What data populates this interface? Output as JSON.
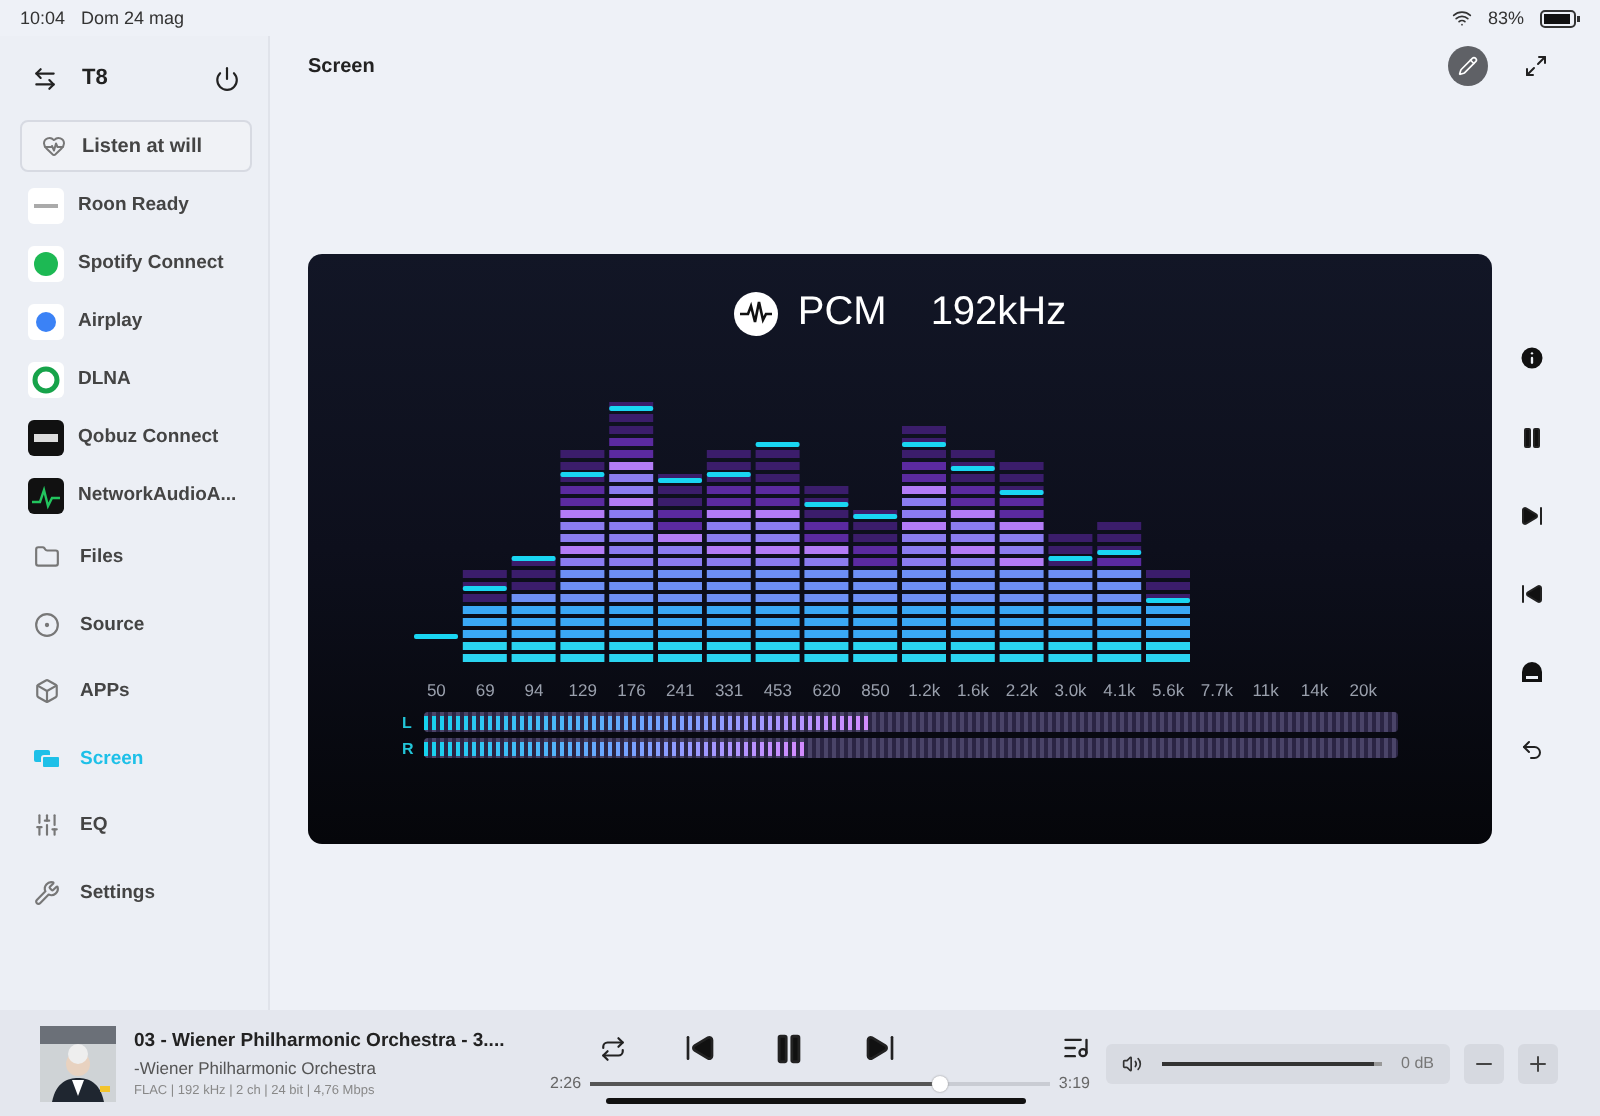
{
  "status_bar": {
    "time": "10:04",
    "date": "Dom 24 mag",
    "battery": "83%"
  },
  "sidebar": {
    "device": "T8",
    "listen_button": "Listen at will",
    "items": [
      {
        "kind": "source",
        "label": "Roon Ready",
        "selected": false
      },
      {
        "kind": "source",
        "label": "Spotify Connect",
        "selected": false
      },
      {
        "kind": "source",
        "label": "Airplay",
        "selected": false
      },
      {
        "kind": "source",
        "label": "DLNA",
        "selected": false
      },
      {
        "kind": "source",
        "label": "Qobuz Connect",
        "selected": false
      },
      {
        "kind": "source",
        "label": "NetworkAudioA...",
        "selected": false
      },
      {
        "kind": "menu",
        "label": "Files",
        "selected": false
      },
      {
        "kind": "menu",
        "label": "Source",
        "selected": false
      },
      {
        "kind": "menu",
        "label": "APPs",
        "selected": false
      },
      {
        "kind": "menu",
        "label": "Screen",
        "selected": true
      },
      {
        "kind": "menu",
        "label": "EQ",
        "selected": false
      },
      {
        "kind": "menu",
        "label": "Settings",
        "selected": false
      }
    ]
  },
  "page": {
    "title": "Screen"
  },
  "visualizer": {
    "format": "PCM",
    "rate": "192kHz",
    "bands": [
      "50",
      "69",
      "94",
      "129",
      "176",
      "241",
      "331",
      "453",
      "620",
      "850",
      "1.2k",
      "1.6k",
      "2.2k",
      "3.0k",
      "4.1k",
      "5.6k",
      "7.7k",
      "11k",
      "14k",
      "20k"
    ],
    "meters": [
      {
        "label": "L",
        "level": 0.46
      },
      {
        "label": "R",
        "level": 0.39
      }
    ]
  },
  "player": {
    "title": "03 - Wiener Philharmonic Orchestra - 3....",
    "artist": "-Wiener Philharmonic Orchestra",
    "format": "FLAC | 192 kHz | 2 ch | 24 bit | 4,76 Mbps",
    "playing": true,
    "elapsed": "2:26",
    "duration": "3:19",
    "progress": {
      "level": 0.76
    },
    "volume": {
      "level": 0.97,
      "reading": "0 dB"
    }
  }
}
